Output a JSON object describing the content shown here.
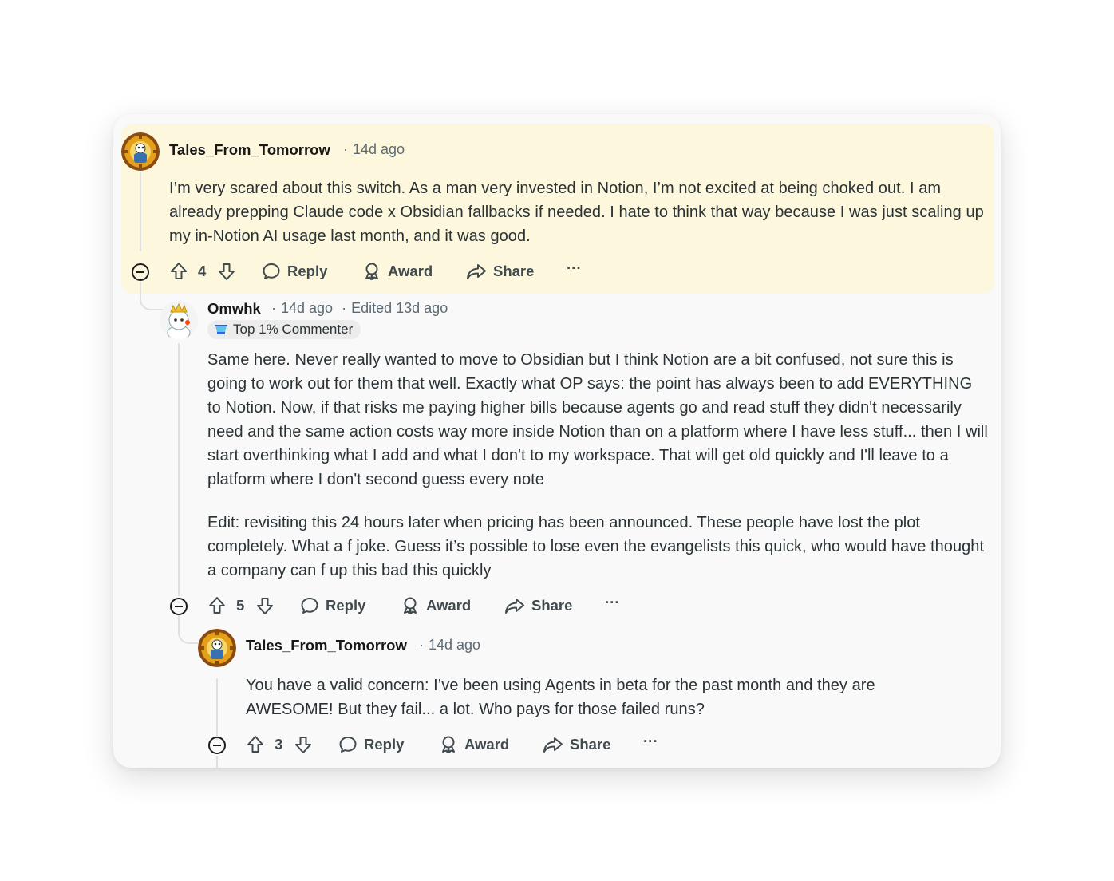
{
  "comments": [
    {
      "username": "Tales_From_Tomorrow",
      "time": "14d ago",
      "body": [
        "I’m very scared about this switch. As a man very invested in Notion, I’m not excited at being choked out. I am already prepping Claude code x Obsidian fallbacks if needed. I hate to think that way because I was just scaling up my in-Notion AI usage last month, and it was good."
      ],
      "votes": "4",
      "reply_label": "Reply",
      "award_label": "Award",
      "share_label": "Share",
      "more_label": "···"
    },
    {
      "username": "Omwhk",
      "time": "14d ago",
      "edited": "Edited 13d ago",
      "badge": "Top 1% Commenter",
      "body": [
        "Same here. Never really wanted to move to Obsidian but I think Notion are a bit confused, not sure this is going to work out for them that well. Exactly what OP says: the point has always been to add EVERYTHING to Notion. Now, if that risks me paying higher bills because agents go and read stuff they didn't necessarily need and the same action costs way more inside Notion than on a platform where I have less stuff... then I will start overthinking what I add and what I don't to my workspace. That will get old quickly and I'll leave to a platform where I don't second guess every note",
        "Edit: revisiting this 24 hours later when pricing has been announced. These people have lost the plot completely. What a f joke. Guess it’s possible to lose even the evangelists this quick, who would have thought a company can f up this bad this quickly"
      ],
      "votes": "5",
      "reply_label": "Reply",
      "award_label": "Award",
      "share_label": "Share",
      "more_label": "···"
    },
    {
      "username": "Tales_From_Tomorrow",
      "time": "14d ago",
      "body": [
        "You have a valid concern: I’ve been using Agents in beta for the past month and they are AWESOME! But they fail... a lot. Who pays for those failed runs?"
      ],
      "votes": "3",
      "reply_label": "Reply",
      "award_label": "Award",
      "share_label": "Share",
      "more_label": "···"
    }
  ],
  "colors": {
    "highlight_bg": "#fdf8dd",
    "card_bg": "#f9f9f9",
    "text": "#2a3236",
    "meta": "#5c6b73"
  },
  "icons": [
    "collapse-icon",
    "upvote-icon",
    "downvote-icon",
    "reply-icon",
    "award-icon",
    "share-icon",
    "more-icon",
    "trophy-icon"
  ]
}
